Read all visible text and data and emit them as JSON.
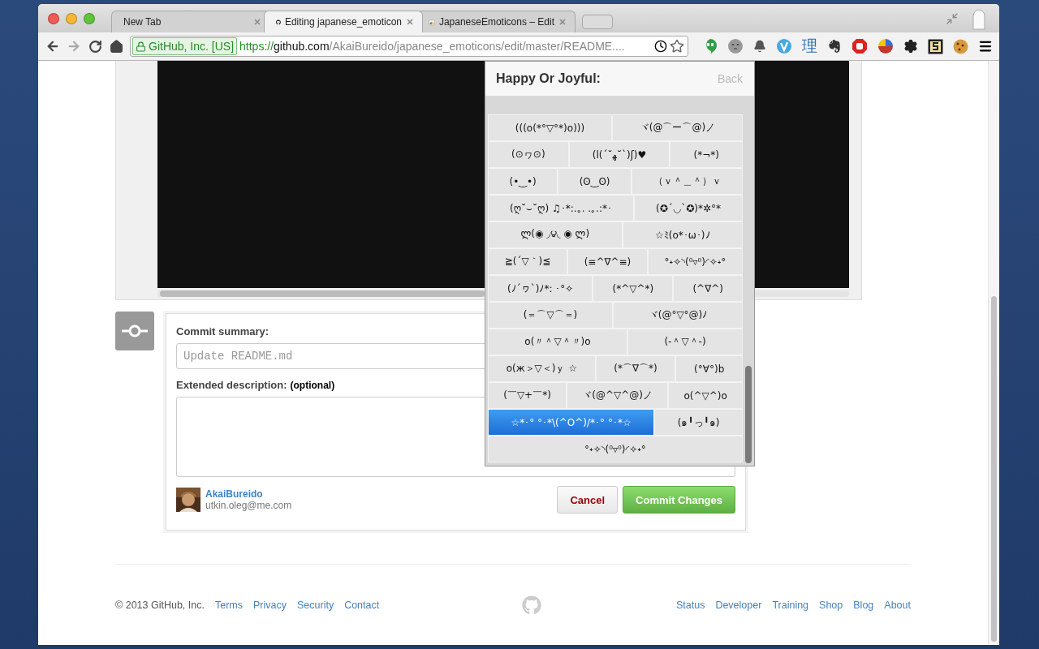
{
  "tabs": [
    {
      "title": "New Tab",
      "selected": false
    },
    {
      "title": "Editing japanese_emoticon",
      "selected": true
    },
    {
      "title": "JapaneseEmoticons – Edit",
      "selected": false
    }
  ],
  "address": {
    "identity": "GitHub, Inc. [US]",
    "scheme": "https://",
    "host": "github.com",
    "path": "/AkaiBureido/japanese_emoticons/edit/master/README...."
  },
  "extension_glyph": "理",
  "popup": {
    "title": "Happy Or Joyful:",
    "back": "Back",
    "rows": [
      [
        {
          "text": "(((o(*°▽°*)o)))",
          "selected": false
        },
        {
          "text": "ヾ(@⌒ー⌒@)ノ",
          "selected": false
        }
      ],
      [
        {
          "text": "(⊙ヮ⊙)",
          "selected": false
        },
        {
          "text": "(l(´˘ﻬ˘`)ʃ)♥",
          "selected": false
        },
        {
          "text": "(*¬*)",
          "selected": false
        }
      ],
      [
        {
          "text": "(•‿•)",
          "selected": false
        },
        {
          "text": "(ʘ‿ʘ)",
          "selected": false
        },
        {
          "text": "（ｖ＾＿＾）ｖ",
          "selected": false
        }
      ],
      [
        {
          "text": "(ღ˘⌣˘ღ) ♫･*:.｡. .｡.:*･",
          "selected": false
        },
        {
          "text": "(✪´◡`✪)*✲°*",
          "selected": false
        }
      ],
      [
        {
          "text": "ლ(◉ ◞౪◟ ◉ ლ)",
          "selected": false
        },
        {
          "text": "☆ﾐ(o*･ω･)ﾉ",
          "selected": false
        }
      ],
      [
        {
          "text": "≧(´▽｀)≦",
          "selected": false
        },
        {
          "text": "(≡^∇^≡)",
          "selected": false
        },
        {
          "text": "°˖✧◝(⁰▿⁰)◜✧˖°",
          "selected": false
        }
      ],
      [
        {
          "text": "(ﾉ´ヮ`)ﾉ*: ･°✧",
          "selected": false
        },
        {
          "text": "(*^▽^*)",
          "selected": false
        },
        {
          "text": "(^∇^)",
          "selected": false
        }
      ],
      [
        {
          "text": "(＝⌒▽⌒＝)",
          "selected": false
        },
        {
          "text": "ヾ(@°▽°@)ﾉ",
          "selected": false
        }
      ],
      [
        {
          "text": "o(〃＾▽＾〃)o",
          "selected": false
        },
        {
          "text": "(-＾▽＾-)",
          "selected": false
        }
      ],
      [
        {
          "text": "o(ж＞▽＜)ｙ ☆",
          "selected": false
        },
        {
          "text": "(*⌒∇⌒*)",
          "selected": false
        },
        {
          "text": "(°∀°)b",
          "selected": false
        }
      ],
      [
        {
          "text": "(￣▽+￣*)",
          "selected": false
        },
        {
          "text": "ヾ(@^▽^@)ノ",
          "selected": false
        },
        {
          "text": "o(^▽^)o",
          "selected": false
        }
      ],
      [
        {
          "text": "☆*･° °･*\\(^O^)/*･° °･*☆",
          "selected": true
        },
        {
          "text": "(๑╹っ╹๑)",
          "selected": false
        }
      ],
      [
        {
          "text": "°˖✧◝(⁰▿⁰)◜✧˖°",
          "selected": false
        }
      ]
    ]
  },
  "commit": {
    "summary_label": "Commit summary:",
    "summary_placeholder": "Update README.md",
    "description_label": "Extended description:",
    "description_hint": "(optional)",
    "author": "AkaiBureido",
    "email": "utkin.oleg@me.com",
    "cancel": "Cancel",
    "submit": "Commit Changes"
  },
  "footer": {
    "copyright": "© 2013 GitHub, Inc.",
    "left_links": [
      "Terms",
      "Privacy",
      "Security",
      "Contact"
    ],
    "right_links": [
      "Status",
      "Developer",
      "Training",
      "Shop",
      "Blog",
      "About"
    ]
  }
}
